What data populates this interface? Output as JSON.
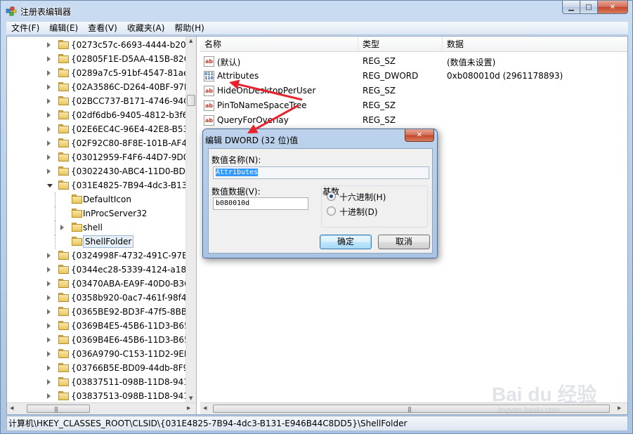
{
  "window": {
    "title": "注册表编辑器",
    "minimize_glyph": "▁",
    "maximize_glyph": "□",
    "close_glyph": "✕"
  },
  "menu": [
    "文件(F)",
    "编辑(E)",
    "查看(V)",
    "收藏夹(A)",
    "帮助(H)"
  ],
  "tree": {
    "rows": [
      {
        "label": "{0273c57c-6693-4444-b20c",
        "level": 0,
        "open": false
      },
      {
        "label": "{02805F1E-D5AA-415B-82C",
        "level": 0,
        "open": false
      },
      {
        "label": "{0289a7c5-91bf-4547-81ae",
        "level": 0,
        "open": false
      },
      {
        "label": "{02A3586C-D264-40BF-97F",
        "level": 0,
        "open": false
      },
      {
        "label": "{02BCC737-B171-4746-94C",
        "level": 0,
        "open": false
      },
      {
        "label": "{02df6db6-9405-4812-b3f6",
        "level": 0,
        "open": false
      },
      {
        "label": "{02E6EC4C-96E4-42E8-B53",
        "level": 0,
        "open": false
      },
      {
        "label": "{02F92C80-8F8E-101B-AF4E",
        "level": 0,
        "open": false
      },
      {
        "label": "{03012959-F4F6-44D7-9D09",
        "level": 0,
        "open": false
      },
      {
        "label": "{03022430-ABC4-11D0-BDE",
        "level": 0,
        "open": false
      },
      {
        "label": "{031E4825-7B94-4dc3-B131",
        "level": 0,
        "open": true
      },
      {
        "label": "DefaultIcon",
        "level": 1,
        "expander": false
      },
      {
        "label": "InProcServer32",
        "level": 1,
        "expander": false
      },
      {
        "label": "shell",
        "level": 1,
        "expander": true
      },
      {
        "label": "ShellFolder",
        "level": 1,
        "expander": false,
        "selected": true
      },
      {
        "label": "{0324998F-4732-491C-97ED",
        "level": 0,
        "open": false
      },
      {
        "label": "{0344ec28-5339-4124-a186",
        "level": 0,
        "open": false
      },
      {
        "label": "{03470ABA-EA9F-40D0-B3C",
        "level": 0,
        "open": false
      },
      {
        "label": "{0358b920-0ac7-461f-98f4-",
        "level": 0,
        "open": false
      },
      {
        "label": "{0365BE92-BD3F-47f5-8BB6",
        "level": 0,
        "open": false
      },
      {
        "label": "{0369B4E5-45B6-11D3-B65",
        "level": 0,
        "open": false
      },
      {
        "label": "{0369B4E6-45B6-11D3-B65",
        "level": 0,
        "open": false
      },
      {
        "label": "{036A9790-C153-11D2-9EF7",
        "level": 0,
        "open": false
      },
      {
        "label": "{03766B5E-BD09-44db-8F9",
        "level": 0,
        "open": false
      },
      {
        "label": "{03837511-098B-11D8-9414",
        "level": 0,
        "open": false
      },
      {
        "label": "{03837513-098B-11D8-9414",
        "level": 0,
        "open": false
      }
    ]
  },
  "list": {
    "columns": [
      "名称",
      "类型",
      "数据"
    ],
    "rows": [
      {
        "icon": "ab",
        "name": "(默认)",
        "type": "REG_SZ",
        "data": "(数值未设置)"
      },
      {
        "icon": "bin",
        "name": "Attributes",
        "type": "REG_DWORD",
        "data": "0xb080010d (2961178893)"
      },
      {
        "icon": "ab",
        "name": "HideOnDesktopPerUser",
        "type": "REG_SZ",
        "data": ""
      },
      {
        "icon": "ab",
        "name": "PinToNameSpaceTree",
        "type": "REG_SZ",
        "data": ""
      },
      {
        "icon": "ab",
        "name": "QueryForOverlay",
        "type": "REG_SZ",
        "data": ""
      }
    ]
  },
  "dialog": {
    "title": "编辑 DWORD (32 位)值",
    "close_glyph": "✕",
    "name_label": "数值名称(N):",
    "name_value": "Attributes",
    "data_label": "数值数据(V):",
    "data_value": "b080010d",
    "base_label": "基数",
    "hex_label": "十六进制(H)",
    "dec_label": "十进制(D)",
    "hex_selected": true,
    "ok_label": "确定",
    "cancel_label": "取消"
  },
  "status_path": "计算机\\HKEY_CLASSES_ROOT\\CLSID\\{031E4825-7B94-4dc3-B131-E946B44C8DD5}\\ShellFolder",
  "watermark": {
    "brand": "Bai du 经验",
    "url": "jingyan.baidu.com"
  },
  "annotation_color": "#e8232d"
}
